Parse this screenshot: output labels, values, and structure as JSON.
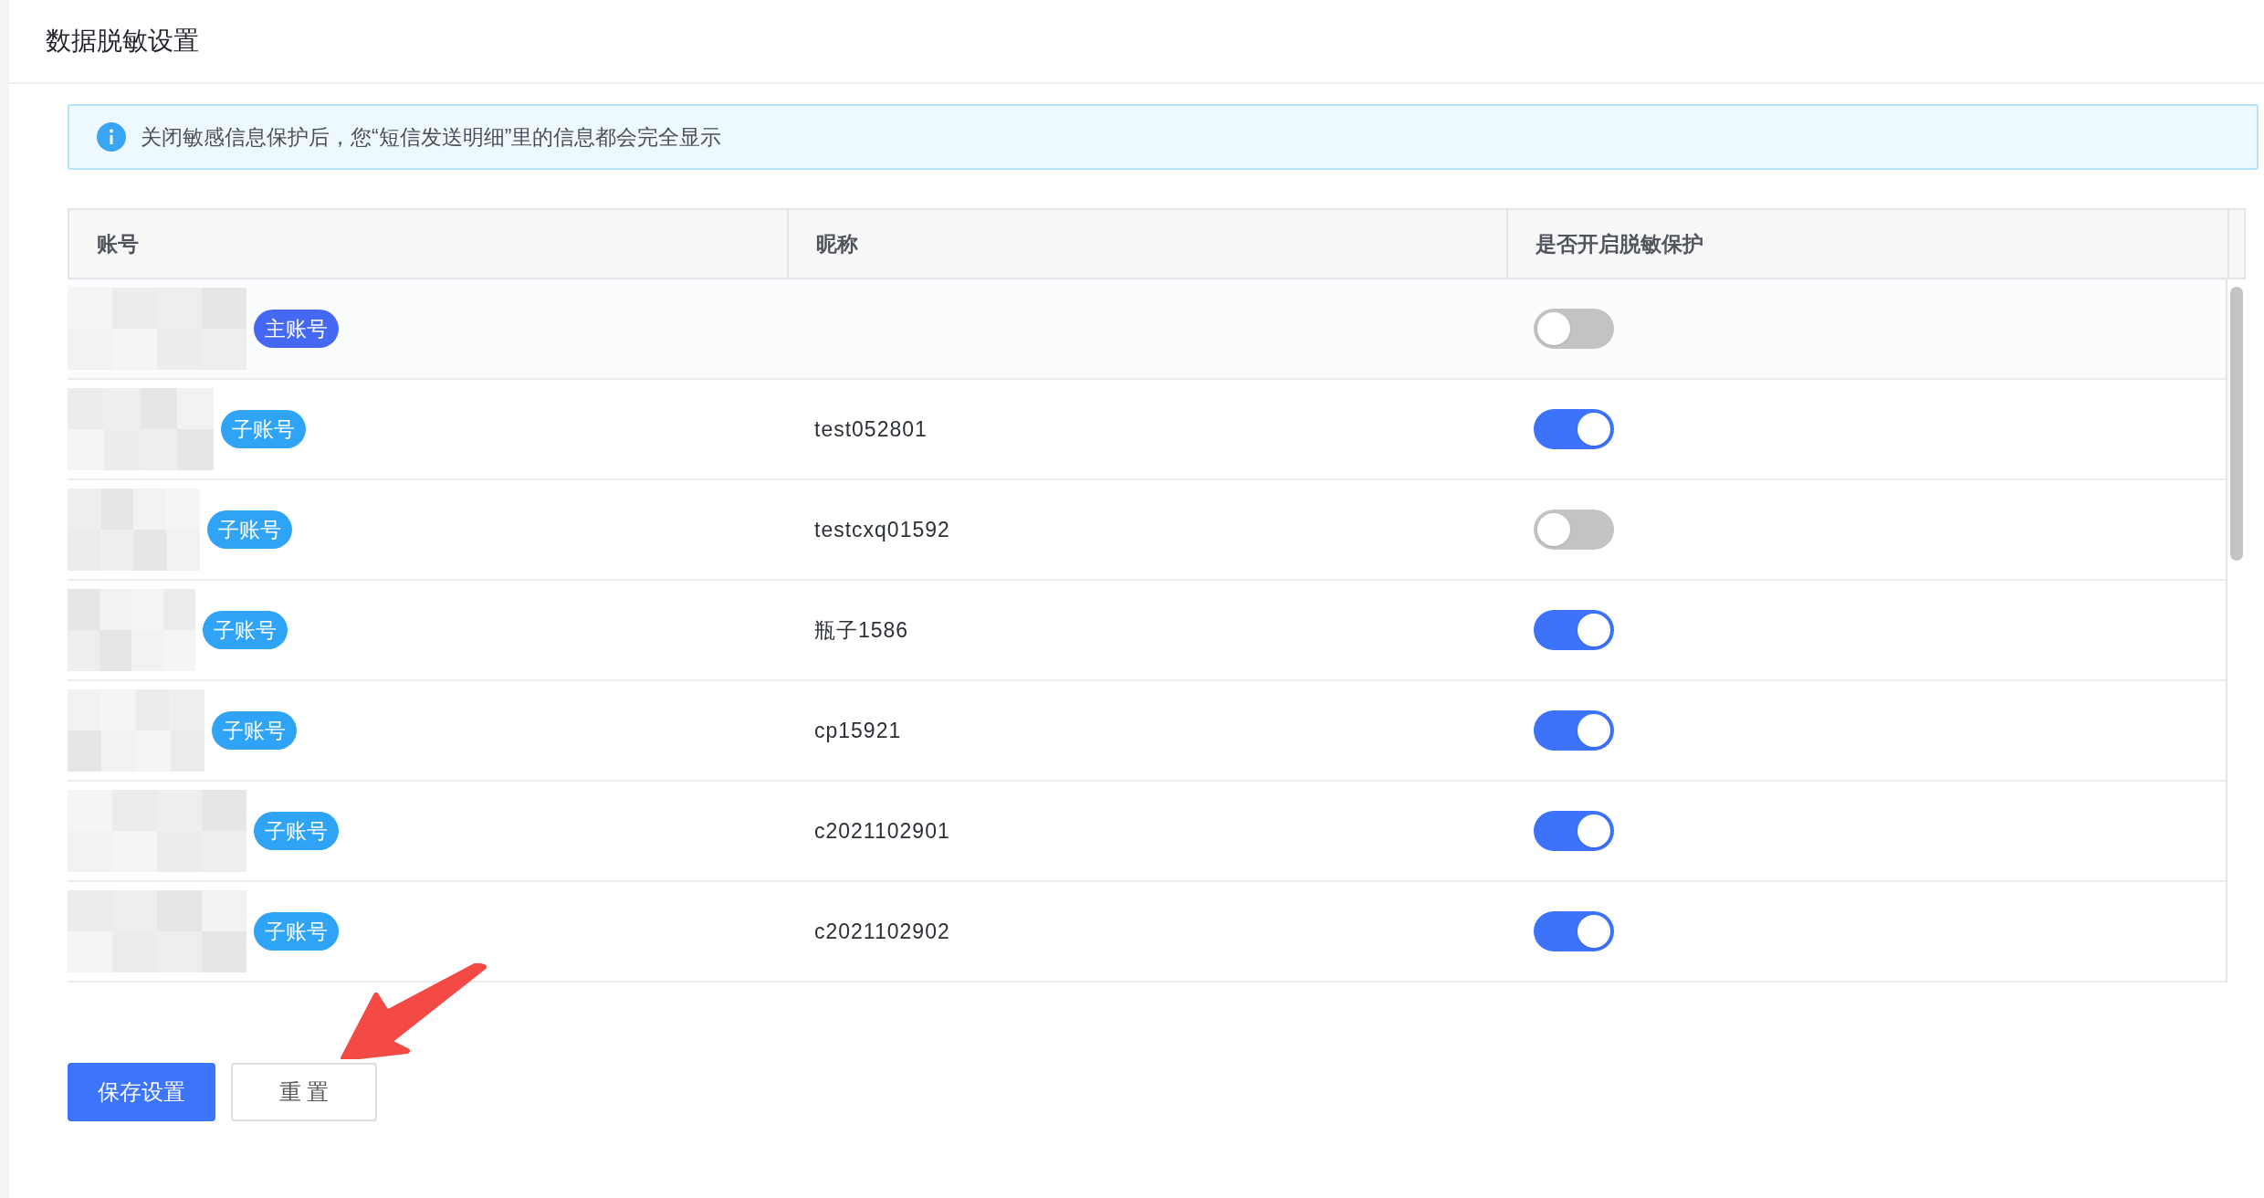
{
  "page_title": "数据脱敏设置",
  "notice": "关闭敏感信息保护后，您“短信发送明细”里的信息都会完全显示",
  "table": {
    "columns": [
      "账号",
      "昵称",
      "是否开启脱敏保护"
    ],
    "rows": [
      {
        "badge": "主账号",
        "kind": "main",
        "nickname": "",
        "on": false
      },
      {
        "badge": "子账号",
        "kind": "sub",
        "nickname": "test052801",
        "on": true
      },
      {
        "badge": "子账号",
        "kind": "sub",
        "nickname": "testcxq01592",
        "on": false
      },
      {
        "badge": "子账号",
        "kind": "sub",
        "nickname": "瓶子1586",
        "on": true
      },
      {
        "badge": "子账号",
        "kind": "sub",
        "nickname": "cp15921",
        "on": true
      },
      {
        "badge": "子账号",
        "kind": "sub",
        "nickname": "c2021102901",
        "on": true
      },
      {
        "badge": "子账号",
        "kind": "sub",
        "nickname": "c2021102902",
        "on": true
      }
    ]
  },
  "buttons": [
    {
      "label": "保存设置",
      "kind": "primary"
    },
    {
      "label": "重 置",
      "kind": "default"
    }
  ]
}
